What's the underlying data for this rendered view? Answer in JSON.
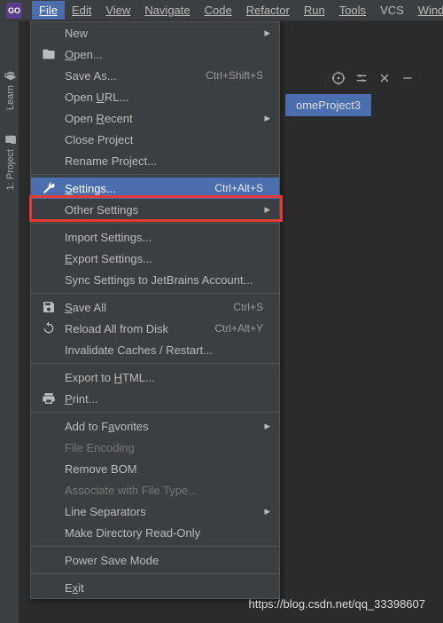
{
  "app_icon": "GO",
  "menubar": {
    "file": "File",
    "edit": "Edit",
    "view": "View",
    "navigate": "Navigate",
    "code": "Code",
    "refactor": "Refactor",
    "run": "Run",
    "tools": "Tools",
    "vcs": "VCS",
    "window": "Wind"
  },
  "gutter": {
    "learn": "Learn",
    "project": "1: Project"
  },
  "tab": {
    "label": "omeProject3"
  },
  "menu": {
    "new": "New",
    "open": "Open...",
    "save_as": "Save As...",
    "save_as_sc": "Ctrl+Shift+S",
    "open_url": "Open URL...",
    "open_recent": "Open Recent",
    "close_project": "Close Project",
    "rename_project": "Rename Project...",
    "settings": "Settings...",
    "settings_sc": "Ctrl+Alt+S",
    "other_settings": "Other Settings",
    "import_settings": "Import Settings...",
    "export_settings": "Export Settings...",
    "sync_settings": "Sync Settings to JetBrains Account...",
    "save_all": "Save All",
    "save_all_sc": "Ctrl+S",
    "reload": "Reload All from Disk",
    "reload_sc": "Ctrl+Alt+Y",
    "invalidate": "Invalidate Caches / Restart...",
    "export_html": "Export to HTML...",
    "print": "Print...",
    "add_fav": "Add to Favorites",
    "file_encoding": "File Encoding",
    "remove_bom": "Remove BOM",
    "associate": "Associate with File Type...",
    "line_sep": "Line Separators",
    "readonly": "Make Directory Read-Only",
    "power_save": "Power Save Mode",
    "exit": "Exit"
  },
  "watermark": "https://blog.csdn.net/qq_33398607"
}
